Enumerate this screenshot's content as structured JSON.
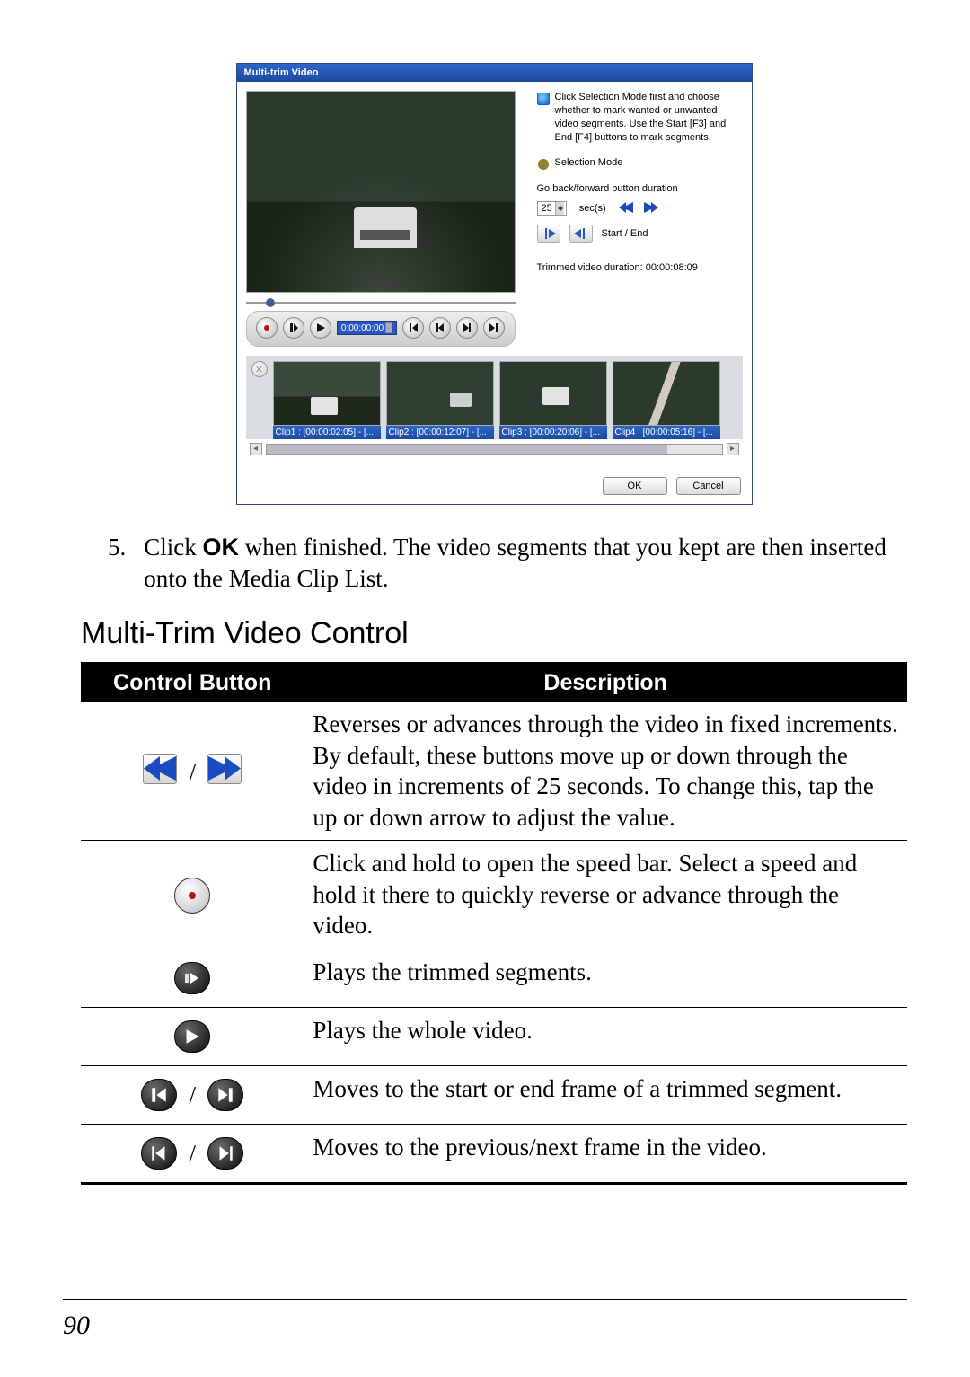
{
  "app": {
    "title": "Multi-trim Video",
    "callouts": {
      "main": "Click Selection Mode first and choose whether to mark wanted or unwanted video segments. Use the Start [F3] and End [F4] buttons to mark segments.",
      "mode": "Selection Mode"
    },
    "duration_label": "Go back/forward button duration",
    "secs_value": "25",
    "secs_label": "sec(s)",
    "startend_label": "Start / End",
    "trimmed_label": "Trimmed video duration: 00:00:08:09",
    "timecode": "0:00:00:00",
    "clips": {
      "c1": "Clip1 : [00:00:02:05] - [...",
      "c2": "Clip2 : [00:00:12:07] - [...",
      "c3": "Clip3 : [00:00:20:06] - [...",
      "c4": "Clip4 : [00:00:05:16] - [..."
    },
    "ok": "OK",
    "cancel": "Cancel"
  },
  "step": {
    "num": "5.",
    "pre": "Click ",
    "bold": "OK",
    "post": " when finished. The video segments that you kept are then inserted onto the Media Clip List."
  },
  "section_title": "Multi-Trim Video Control",
  "table": {
    "h1": "Control Button",
    "h2": "Description",
    "r1": "Reverses or advances through the video in fixed increments. By default, these buttons move up or down through the video in increments of 25 seconds. To change this, tap the up or down arrow to adjust the value.",
    "r2": "Click and hold to open the speed bar. Select a speed and hold it there to quickly reverse or advance through the video.",
    "r3": "Plays the trimmed segments.",
    "r4": "Plays the whole video.",
    "r5": "Moves to the start or end frame of a trimmed segment.",
    "r6": "Moves to the previous/next frame in the video."
  },
  "page_number": "90"
}
